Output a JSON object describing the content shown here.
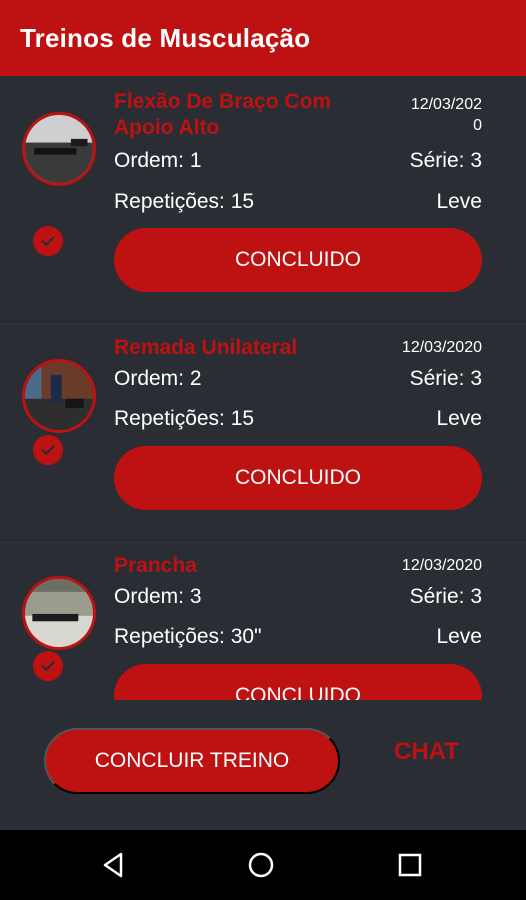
{
  "appbar": {
    "title": "Treinos de Musculação"
  },
  "exercises": [
    {
      "title": "Flexão De Braço Com Apoio Alto",
      "date": "12/03/2020",
      "ordem": "Ordem: 1",
      "serie": "Série: 3",
      "repeticoes": "Repetições: 15",
      "intensidade": "Leve",
      "button": "CONCLUIDO",
      "icon": "check-icon"
    },
    {
      "title": "Remada Unilateral",
      "date": "12/03/2020",
      "ordem": "Ordem: 2",
      "serie": "Série: 3",
      "repeticoes": "Repetições: 15",
      "intensidade": "Leve",
      "button": "CONCLUIDO",
      "icon": "check-icon"
    },
    {
      "title": "Prancha",
      "date": "12/03/2020",
      "ordem": "Ordem: 3",
      "serie": "Série: 3",
      "repeticoes": "Repetições: 30\"",
      "intensidade": "Leve",
      "button": "CONCLUIDO",
      "icon": "check-icon"
    }
  ],
  "footer": {
    "finish_button": "CONCLUIR TREINO",
    "chat_link": "CHAT"
  },
  "navigation": {
    "back": "back-icon",
    "home": "home-icon",
    "recents": "recents-icon"
  },
  "colors": {
    "accent": "#be1111",
    "background": "#2a2d34",
    "text": "#ffffff"
  }
}
